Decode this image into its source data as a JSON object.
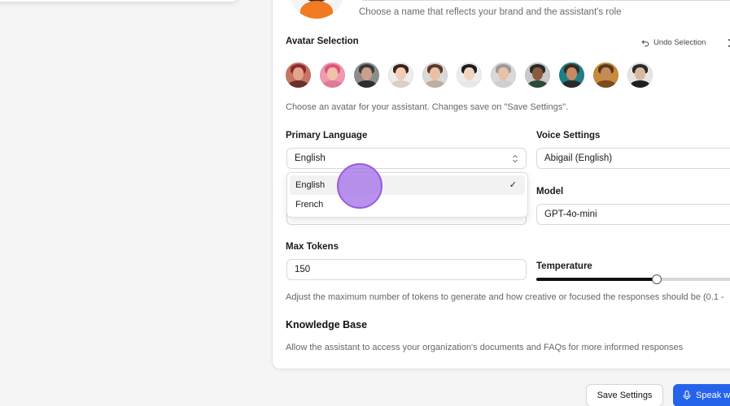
{
  "assistant_name": {
    "helper": "Choose a name that reflects your brand and the assistant's role"
  },
  "avatar_selection": {
    "label": "Avatar Selection",
    "undo_label": "Undo Selection",
    "helper": "Choose an avatar for your assistant. Changes save on \"Save Settings\".",
    "avatars": [
      {
        "name": "avatar-1",
        "skin": "#e0a58a",
        "hair": "#8a2c2c",
        "bg": "#c87463",
        "shirt": "#6b2e2e"
      },
      {
        "name": "avatar-2",
        "skin": "#f2c2a8",
        "hair": "#d9557a",
        "bg": "#f09ab0",
        "shirt": "#e07a99"
      },
      {
        "name": "avatar-3",
        "skin": "#c9a08a",
        "hair": "#3b3b3b",
        "bg": "#8d8d8d",
        "shirt": "#2f2f2f"
      },
      {
        "name": "avatar-4",
        "skin": "#f0cdb8",
        "hair": "#3a2418",
        "bg": "#ededed",
        "shirt": "#d9d0c6"
      },
      {
        "name": "avatar-5",
        "skin": "#e9c0a3",
        "hair": "#5b3b28",
        "bg": "#d9d9d9",
        "shirt": "#bcaea0"
      },
      {
        "name": "avatar-6",
        "skin": "#f2d3c0",
        "hair": "#1e1e1e",
        "bg": "#ededed",
        "shirt": "#e8e8e8"
      },
      {
        "name": "avatar-7",
        "skin": "#e8c2a6",
        "hair": "#9a9a9a",
        "bg": "#d9d9d9",
        "shirt": "#cfcfcf"
      },
      {
        "name": "avatar-8",
        "skin": "#8a5b3f",
        "hair": "#2a2a2a",
        "bg": "#c9c9c9",
        "shirt": "#2e4a3a"
      },
      {
        "name": "avatar-9",
        "skin": "#c68a66",
        "hair": "#3a2a20",
        "bg": "#1f7f86",
        "shirt": "#2a2a2a"
      },
      {
        "name": "avatar-10",
        "skin": "#c58a5a",
        "hair": "#5a3820",
        "bg": "#c98a3a",
        "shirt": "#7a4a20"
      },
      {
        "name": "avatar-11",
        "skin": "#d9b8a0",
        "hair": "#2a2a2a",
        "bg": "#e5e5e5",
        "shirt": "#1f1f1f"
      }
    ]
  },
  "primary_language": {
    "label": "Primary Language",
    "value": "English",
    "options": [
      {
        "label": "English",
        "selected": true
      },
      {
        "label": "French",
        "selected": false
      }
    ],
    "check": "✓"
  },
  "voice_settings": {
    "label": "Voice Settings",
    "value": "Abigail (English)"
  },
  "model": {
    "label": "Model",
    "value": "GPT-4o-mini"
  },
  "max_tokens": {
    "label": "Max Tokens",
    "value": "150"
  },
  "temperature": {
    "label": "Temperature",
    "level": 0.57
  },
  "tokens_helper": "Adjust the maximum number of tokens to generate and how creative or focused the responses should be (0.1 -",
  "knowledge_base": {
    "title": "Knowledge Base",
    "helper": "Allow the assistant to access your organization's documents and FAQs for more informed responses"
  },
  "footer": {
    "save_label": "Save Settings",
    "speak_label": "Speak w"
  },
  "colors": {
    "accent": "#2563eb",
    "cursor": "#a06ee6"
  }
}
